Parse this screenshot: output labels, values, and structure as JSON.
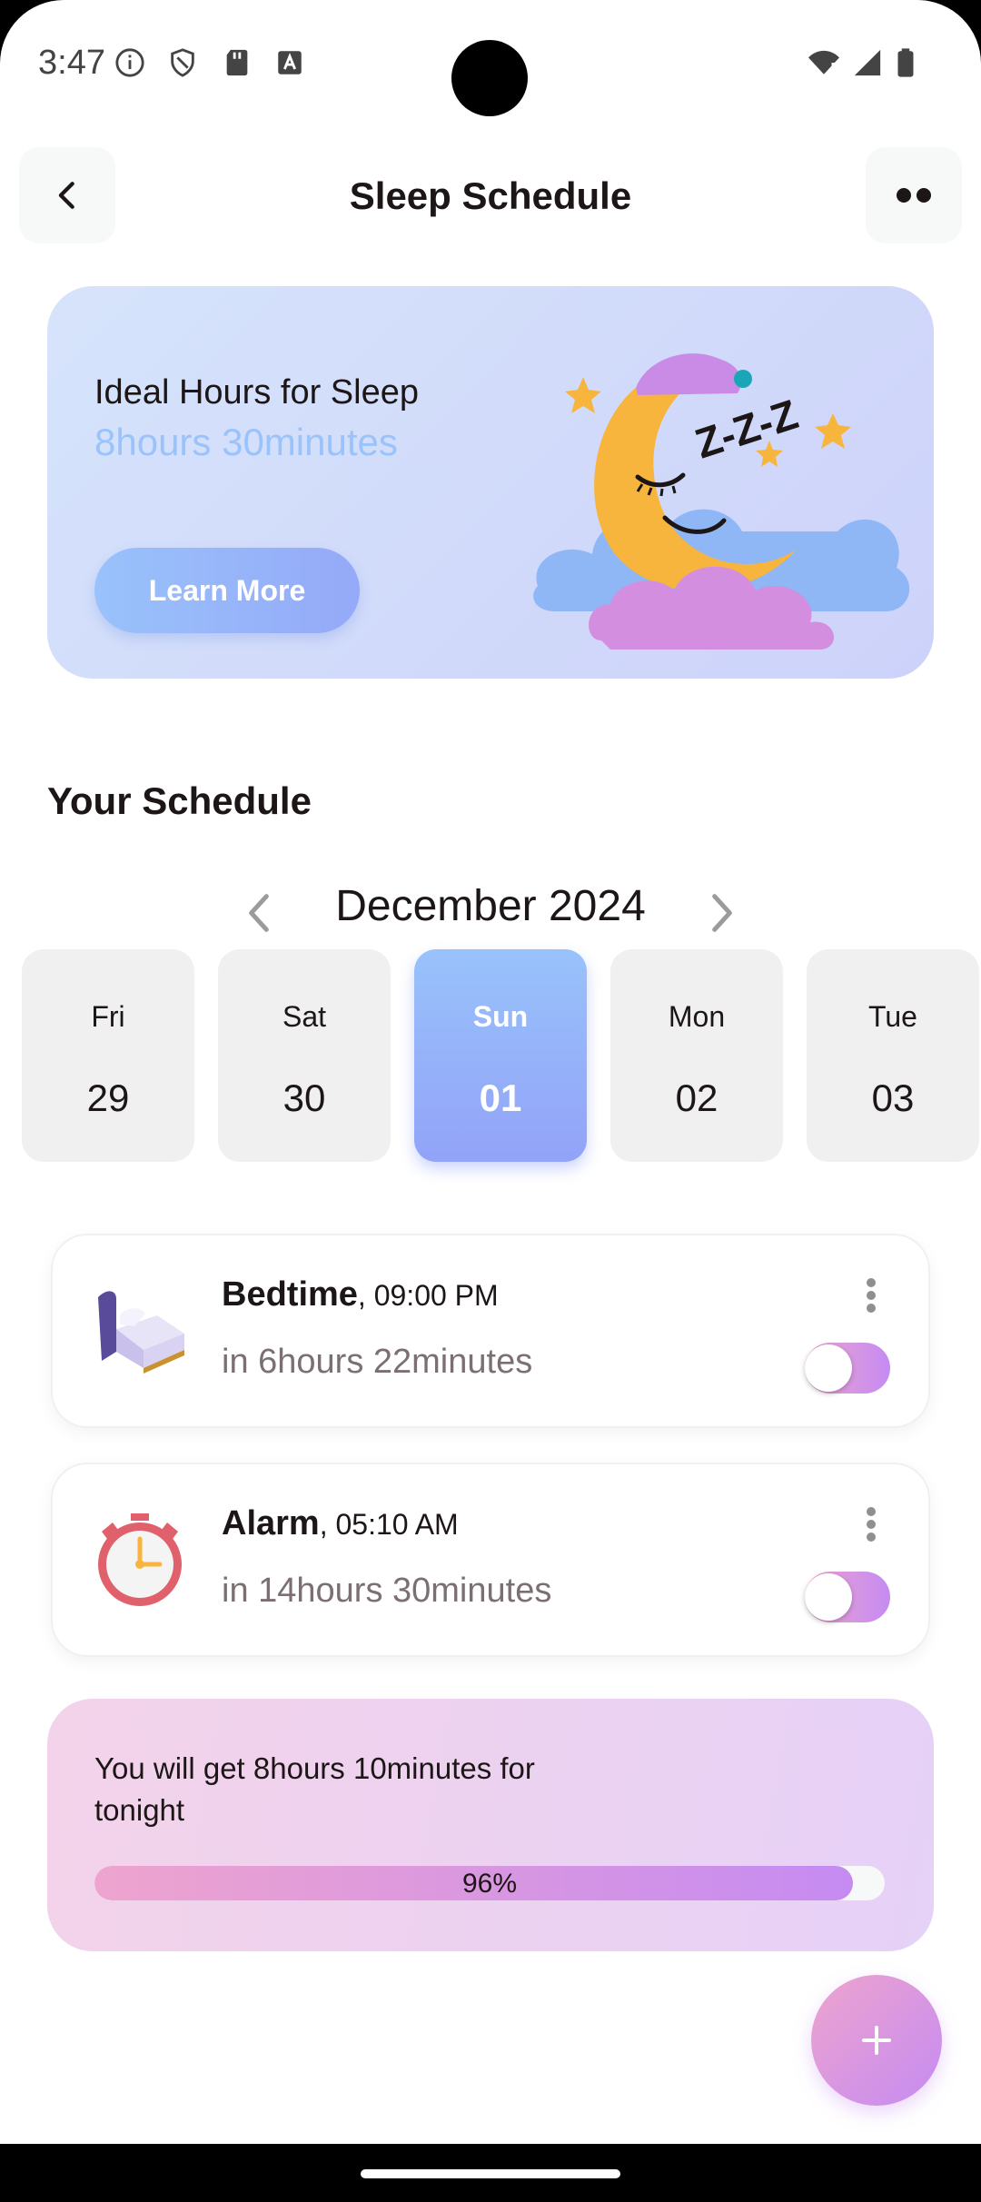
{
  "status_bar": {
    "time": "3:47",
    "left_icons": [
      "info-icon",
      "shield-icon",
      "sd-card-icon",
      "keyboard-icon"
    ],
    "right_icons": [
      "wifi-icon",
      "signal-icon",
      "battery-icon"
    ]
  },
  "header": {
    "title": "Sleep Schedule",
    "back_icon": "chevron-left-icon",
    "menu_icon": "more-horizontal-icon"
  },
  "banner": {
    "line1": "Ideal Hours for Sleep",
    "line2": "8hours 30minutes",
    "button": "Learn More",
    "illustration_text": "Z-Z-Z"
  },
  "schedule": {
    "title": "Your Schedule",
    "month": "December 2024",
    "days": [
      {
        "name": "Fri",
        "date": "29",
        "selected": false
      },
      {
        "name": "Sat",
        "date": "30",
        "selected": false
      },
      {
        "name": "Sun",
        "date": "01",
        "selected": true
      },
      {
        "name": "Mon",
        "date": "02",
        "selected": false
      },
      {
        "name": "Tue",
        "date": "03",
        "selected": false
      }
    ]
  },
  "cards": [
    {
      "title": "Bedtime",
      "time": ", 09:00 PM",
      "subtitle": "in 6hours 22minutes",
      "icon": "bed-icon",
      "enabled": true
    },
    {
      "title": "Alarm",
      "time": ", 05:10 AM",
      "subtitle": "in 14hours 30minutes",
      "icon": "alarm-clock-icon",
      "enabled": true
    }
  ],
  "summary": {
    "text": "You will get 8hours 10minutes for tonight",
    "progress_label": "96%",
    "progress_value": 0.96
  },
  "fab": {
    "icon": "plus-icon"
  },
  "colors": {
    "primary_blue": "#92A3F8",
    "light_blue": "#99C2FB",
    "pink": "#EEA4CE",
    "purple": "#C58BF2",
    "text": "#1D1617",
    "gray_text": "#7B6F72"
  }
}
